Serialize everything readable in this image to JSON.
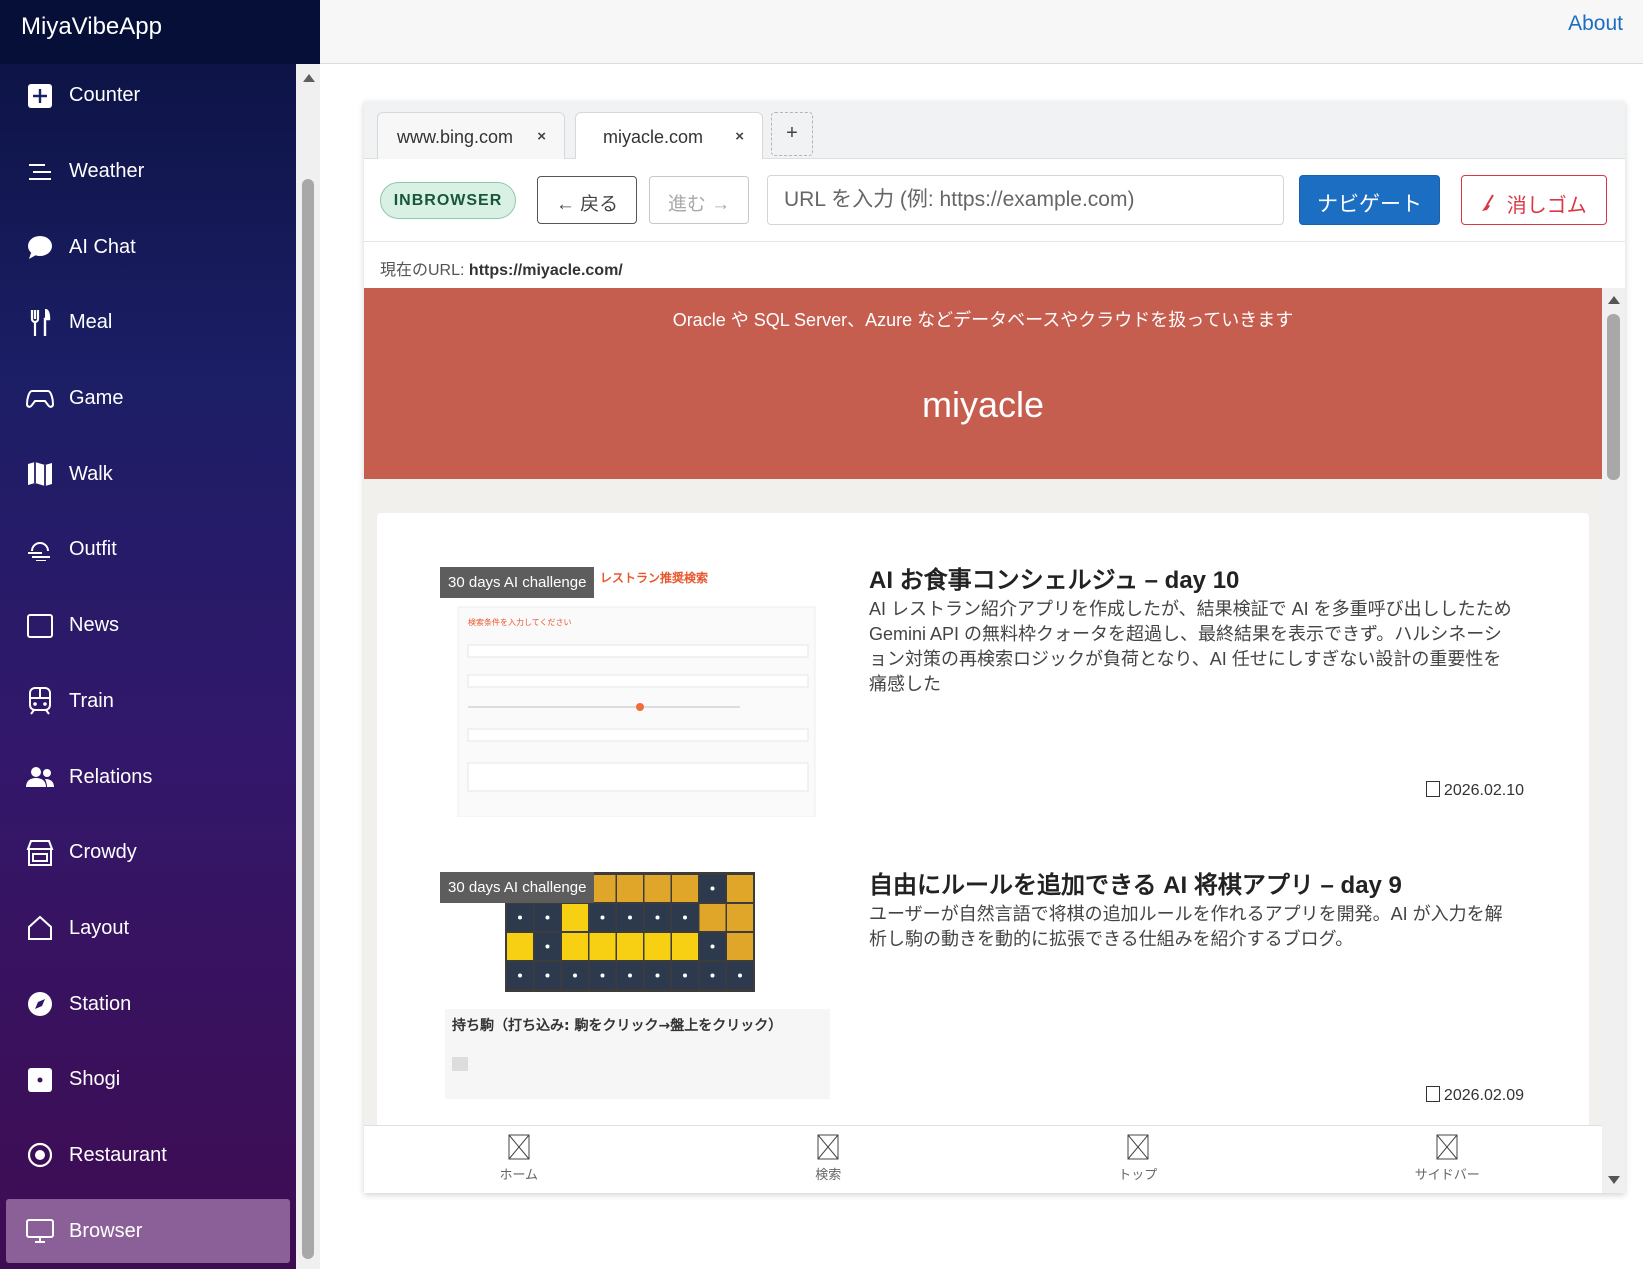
{
  "app": {
    "title": "MiyaVibeApp",
    "about_label": "About"
  },
  "sidebar": {
    "items": [
      {
        "label": "Counter",
        "icon": "plus-square-icon"
      },
      {
        "label": "Weather",
        "icon": "list-icon"
      },
      {
        "label": "AI Chat",
        "icon": "chat-bubble-icon"
      },
      {
        "label": "Meal",
        "icon": "utensils-icon"
      },
      {
        "label": "Game",
        "icon": "gamepad-icon"
      },
      {
        "label": "Walk",
        "icon": "map-icon"
      },
      {
        "label": "Outfit",
        "icon": "weather-haze-icon"
      },
      {
        "label": "News",
        "icon": "window-icon"
      },
      {
        "label": "Train",
        "icon": "train-icon"
      },
      {
        "label": "Relations",
        "icon": "people-icon"
      },
      {
        "label": "Crowdy",
        "icon": "shop-icon"
      },
      {
        "label": "Layout",
        "icon": "house-icon"
      },
      {
        "label": "Station",
        "icon": "compass-icon"
      },
      {
        "label": "Shogi",
        "icon": "square-dot-icon"
      },
      {
        "label": "Restaurant",
        "icon": "dish-icon"
      },
      {
        "label": "Browser",
        "icon": "monitor-icon",
        "active": true
      }
    ]
  },
  "browser": {
    "tabs": [
      {
        "label": "www.bing.com",
        "close": "×"
      },
      {
        "label": "miyacle.com",
        "close": "×"
      }
    ],
    "add_tab": "+",
    "mode_badge": "INBROWSER",
    "back_label": "← 戻る",
    "forward_label": "進む →",
    "url_placeholder": "URL を入力 (例: https://example.com)",
    "navigate_label": "ナビゲート",
    "eraser_label": "消しゴム",
    "current_url_label": "現在のURL:",
    "current_url": "https://miyacle.com/"
  },
  "site": {
    "description": "Oracle や SQL Server、Azure などデータベースやクラウドを扱っていきます",
    "title": "miyacle",
    "posts": [
      {
        "badge": "30 days AI challenge",
        "title": "AI お食事コンシェルジュ – day 10",
        "excerpt": "AI レストラン紹介アプリを作成したが、結果検証で AI を多重呼び出ししたため Gemini API の無料枠クォータを超過し、最終結果を表示できず。ハルシネーション対策の再検索ロジックが負荷となり、AI 任せにしすぎない設計の重要性を痛感した",
        "date": "2026.02.10",
        "thumb_heading": "レストラン推奨検索",
        "thumb_form_title": "検索条件を入力してください"
      },
      {
        "badge": "30 days AI challenge",
        "title": "自由にルールを追加できる AI 将棋アプリ – day 9",
        "excerpt": "ユーザーが自然言語で将棋の追加ルールを作れるアプリを開発。AI が入力を解析し駒の動きを動的に拡張できる仕組みを紹介するブログ。",
        "date": "2026.02.09",
        "thumb_caption": "持ち駒（打ち込み: 駒をクリック→盤上をクリック）"
      }
    ],
    "bottom_nav": [
      "ホーム",
      "検索",
      "トップ",
      "サイドバー"
    ]
  }
}
